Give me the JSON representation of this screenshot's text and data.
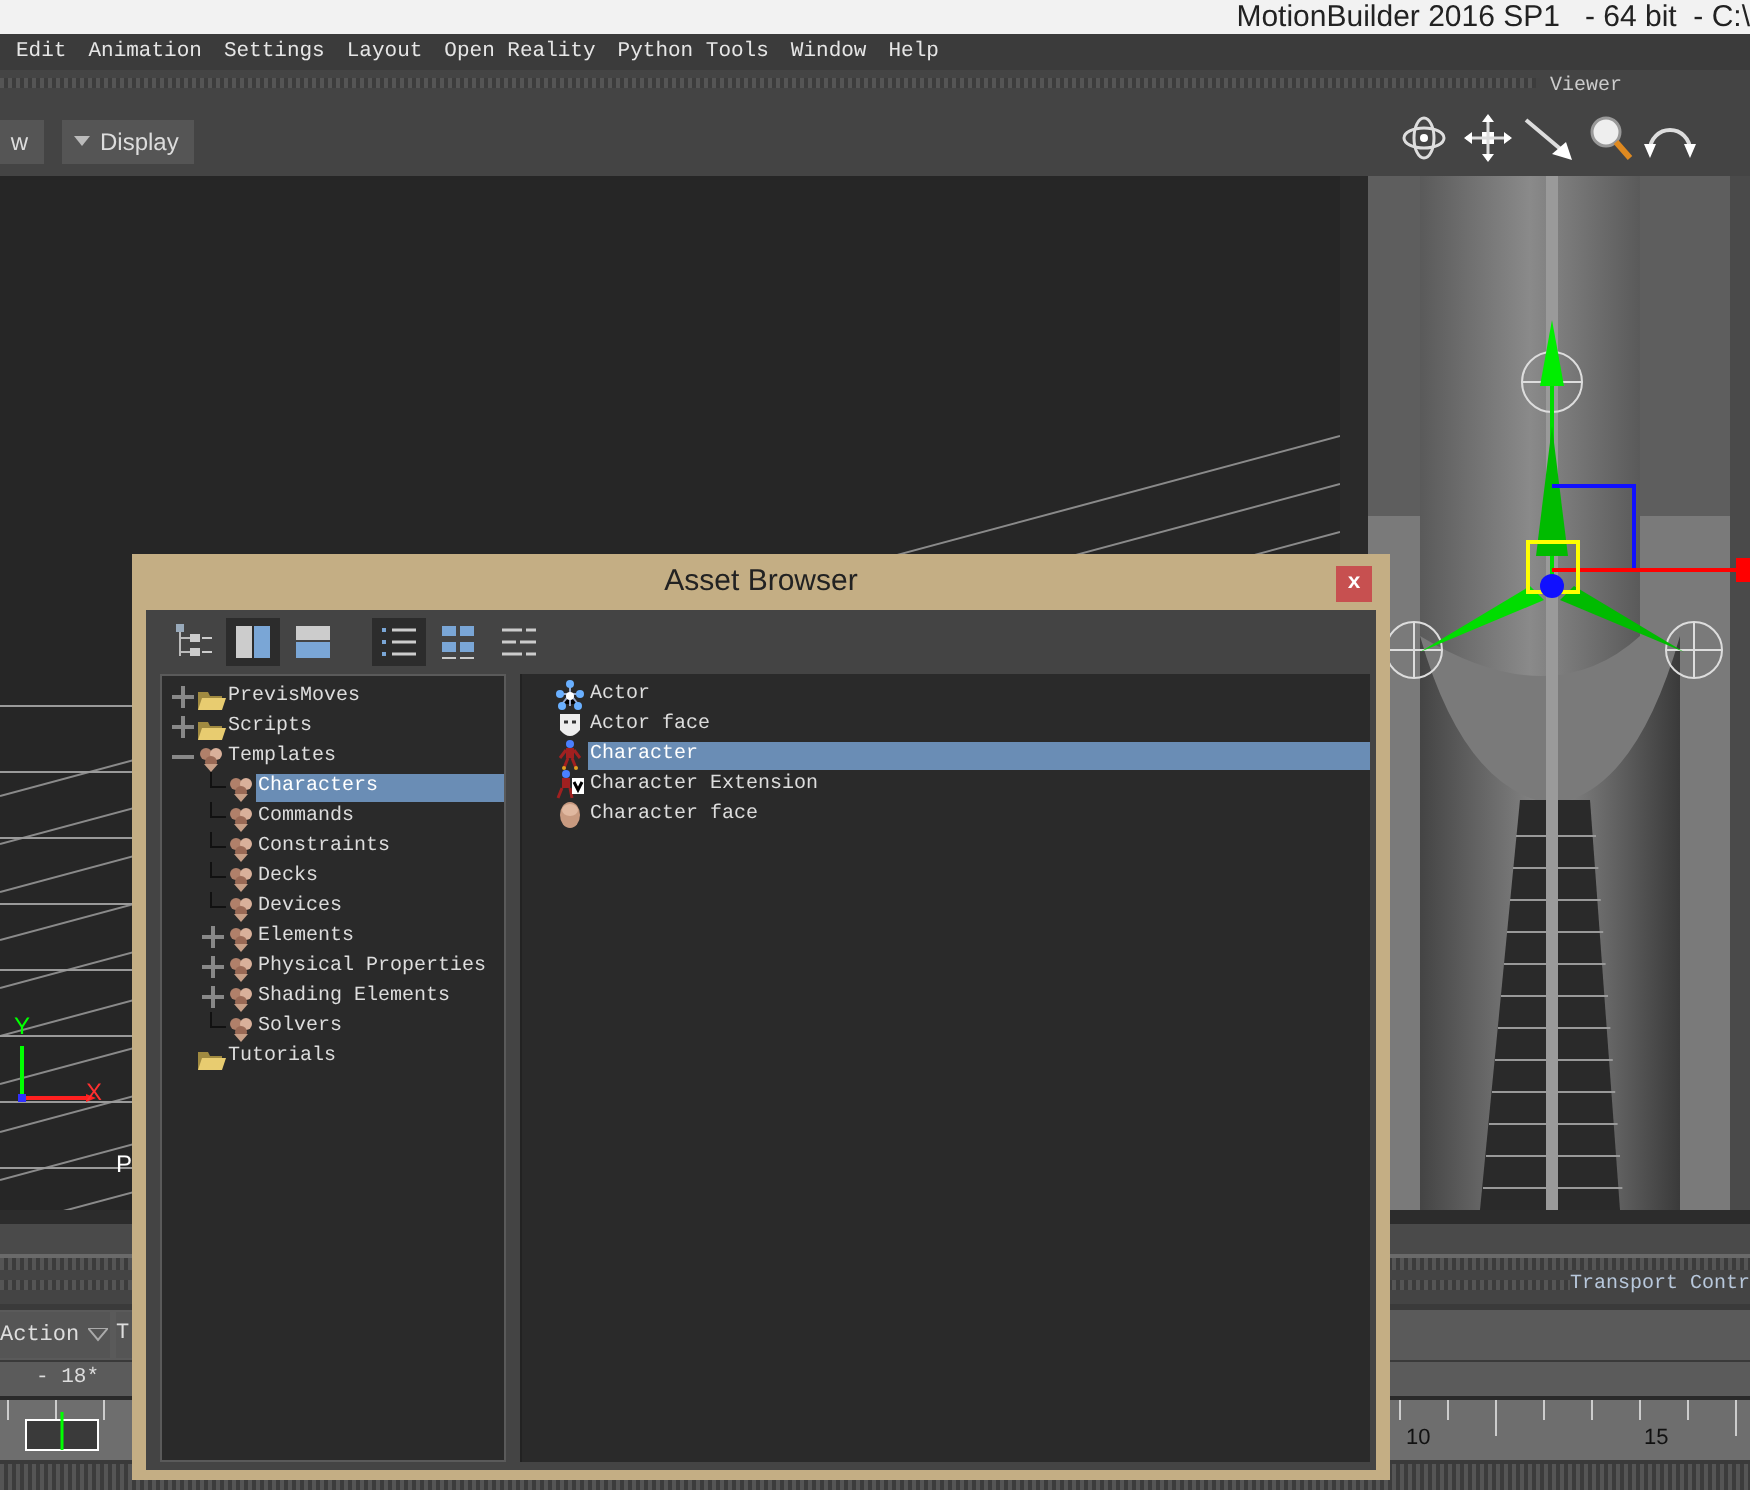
{
  "window": {
    "title": "MotionBuilder 2016 SP1   - 64 bit  - C:\\"
  },
  "menu": [
    "Edit",
    "Animation",
    "Settings",
    "Layout",
    "Open Reality",
    "Python Tools",
    "Window",
    "Help"
  ],
  "viewer": {
    "title": "Viewer",
    "buttons": [
      {
        "label": "w"
      },
      {
        "label": "Display",
        "caret": true
      }
    ],
    "axis_labels": [
      "Y",
      "X"
    ],
    "camera_label": "P"
  },
  "bottom": {
    "panel_title": "Transport Contr",
    "action_dropdown": "Action",
    "field_text": "T",
    "frame": "- 18*",
    "timeline_labels": [
      "10",
      "15"
    ]
  },
  "asset_browser": {
    "title": "Asset Browser",
    "close_label": "x",
    "toolbar": [
      [
        {
          "kind": "tree",
          "selected": false
        },
        {
          "kind": "split-vertical",
          "selected": true
        },
        {
          "kind": "split-horizontal",
          "selected": false
        }
      ],
      [
        {
          "kind": "list",
          "selected": true
        },
        {
          "kind": "icons",
          "selected": false
        },
        {
          "kind": "details",
          "selected": false
        }
      ]
    ],
    "tree": [
      {
        "label": "PrevisMoves",
        "kind": "folder",
        "expanded": false,
        "selected": false
      },
      {
        "label": "Scripts",
        "kind": "folder",
        "expanded": false,
        "selected": false
      },
      {
        "label": "Templates",
        "kind": "template",
        "expanded": true,
        "selected": false,
        "children": [
          {
            "label": "Characters",
            "kind": "template",
            "selected": true
          },
          {
            "label": "Commands",
            "kind": "template",
            "selected": false
          },
          {
            "label": "Constraints",
            "kind": "template",
            "selected": false
          },
          {
            "label": "Decks",
            "kind": "template",
            "selected": false
          },
          {
            "label": "Devices",
            "kind": "template",
            "selected": false
          },
          {
            "label": "Elements",
            "kind": "template",
            "expanded": false,
            "selected": false
          },
          {
            "label": "Physical Properties",
            "kind": "template",
            "expanded": false,
            "selected": false
          },
          {
            "label": "Shading Elements",
            "kind": "template",
            "expanded": false,
            "selected": false
          },
          {
            "label": "Solvers",
            "kind": "template",
            "selected": false
          }
        ]
      },
      {
        "label": "Tutorials",
        "kind": "folder",
        "selected": false
      }
    ],
    "assets": [
      {
        "label": "Actor",
        "kind": "actor",
        "selected": false
      },
      {
        "label": "Actor face",
        "kind": "mask",
        "selected": false
      },
      {
        "label": "Character",
        "kind": "character",
        "selected": true
      },
      {
        "label": "Character Extension",
        "kind": "character-extension",
        "selected": false
      },
      {
        "label": "Character face",
        "kind": "head",
        "selected": false
      }
    ]
  }
}
